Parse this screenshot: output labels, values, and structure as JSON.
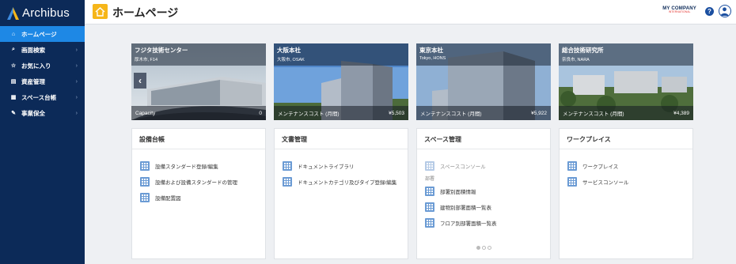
{
  "app": {
    "name": "Archibus"
  },
  "sidebar": {
    "items": [
      {
        "label": "ホームページ",
        "icon": "home-icon",
        "active": true
      },
      {
        "label": "画面検索",
        "icon": "search-icon"
      },
      {
        "label": "お気に入り",
        "icon": "star-icon"
      },
      {
        "label": "資産管理",
        "icon": "document-icon"
      },
      {
        "label": "スペース台帳",
        "icon": "table-icon"
      },
      {
        "label": "事業保全",
        "icon": "wrench-icon"
      }
    ]
  },
  "header": {
    "title": "ホームページ",
    "company_name": "MY COMPANY",
    "company_sub": "INTERNATIONAL",
    "help_label": "?"
  },
  "tiles": [
    {
      "name": "フジタ技術センター",
      "sub": "厚木市, F14",
      "footer_label": "Capacity",
      "footer_value": "0"
    },
    {
      "name": "大阪本社",
      "sub": "大阪市, OSAK",
      "footer_label": "メンテナンスコスト (月間)",
      "footer_value": "¥5,503"
    },
    {
      "name": "東京本社",
      "sub": "Tokyo, HONS",
      "footer_label": "メンテナンスコスト (月間)",
      "footer_value": "¥5,922"
    },
    {
      "name": "総合技術研究所",
      "sub": "奈良市, NARA",
      "footer_label": "メンテナンスコスト (月間)",
      "footer_value": "¥4,389"
    }
  ],
  "cards": [
    {
      "title": "設備台帳",
      "links": [
        "設備スタンダード登録/編集",
        "設備および設備スタンダードの管理",
        "設備配置図"
      ]
    },
    {
      "title": "文書管理",
      "links": [
        "ドキュメントライブラリ",
        "ドキュメントカテゴリ及びタイプ登録/編集"
      ]
    },
    {
      "title": "スペース管理",
      "top_link": "スペースコンソール",
      "section": "部署",
      "links": [
        "部署別面積情報",
        "建物別部署面積一覧表",
        "フロア別部署面積一覧表"
      ]
    },
    {
      "title": "ワークプレイス",
      "links": [
        "ワークプレイス",
        "サービスコンソール"
      ]
    }
  ],
  "colors": {
    "sidebar": "#0c2a58",
    "active": "#1e88e5",
    "accent": "#f6b619"
  }
}
